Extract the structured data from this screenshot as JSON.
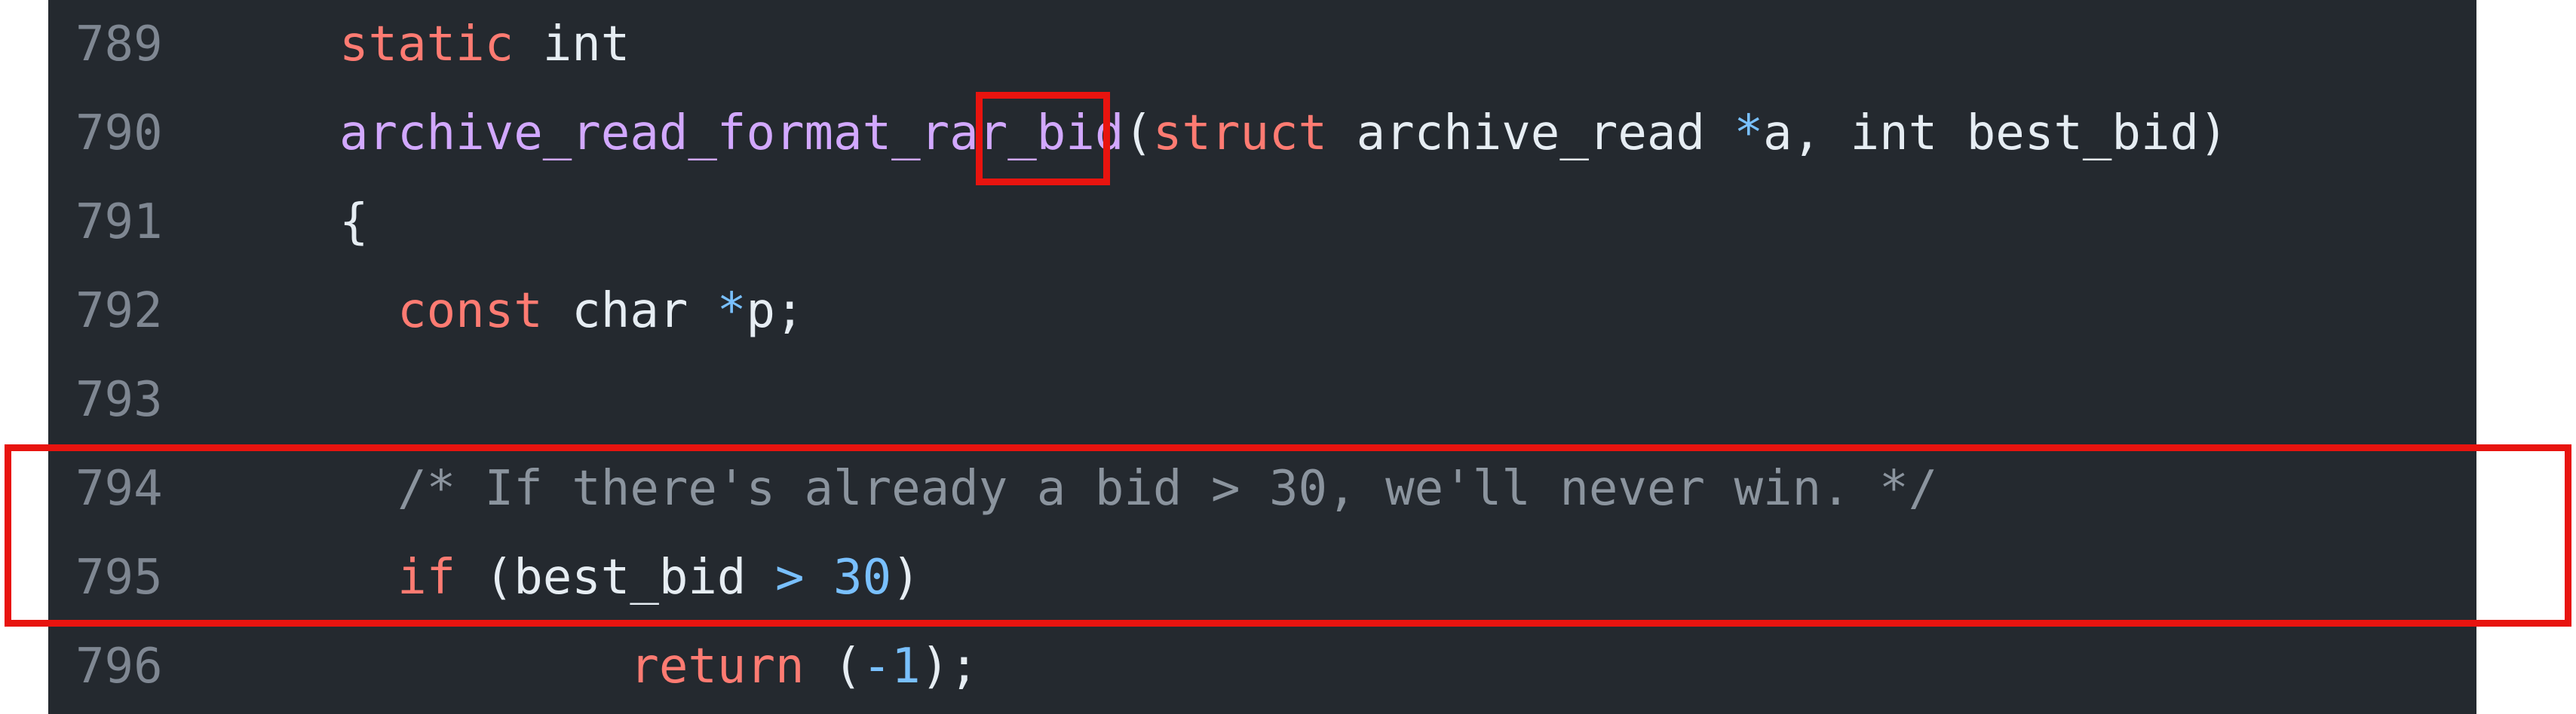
{
  "code_view": {
    "colors": {
      "background": "#24292f",
      "line_number": "#7f8792",
      "keyword": "#ff7b72",
      "function": "#d2a8ff",
      "operator": "#79c0ff",
      "number": "#79c0ff",
      "comment": "#8b949e",
      "plain": "#e6edf3",
      "annotation_box": "#e8140f"
    },
    "lines": [
      {
        "number": "789",
        "tokens": [
          {
            "text": "static",
            "kind": "keyword"
          },
          {
            "text": " int",
            "kind": "plain"
          }
        ]
      },
      {
        "number": "790",
        "tokens": [
          {
            "text": "archive_read_format_rar_bid",
            "kind": "function"
          },
          {
            "text": "(",
            "kind": "plain"
          },
          {
            "text": "struct",
            "kind": "keyword"
          },
          {
            "text": " archive_read ",
            "kind": "plain"
          },
          {
            "text": "*",
            "kind": "operator"
          },
          {
            "text": "a, int best_bid)",
            "kind": "plain"
          }
        ]
      },
      {
        "number": "791",
        "tokens": [
          {
            "text": "{",
            "kind": "plain"
          }
        ]
      },
      {
        "number": "792",
        "tokens": [
          {
            "text": "  ",
            "kind": "plain"
          },
          {
            "text": "const",
            "kind": "keyword"
          },
          {
            "text": " char ",
            "kind": "plain"
          },
          {
            "text": "*",
            "kind": "operator"
          },
          {
            "text": "p;",
            "kind": "plain"
          }
        ]
      },
      {
        "number": "793",
        "tokens": []
      },
      {
        "number": "794",
        "tokens": [
          {
            "text": "  ",
            "kind": "plain"
          },
          {
            "text": "/* If there's already a bid > 30, we'll never win. */",
            "kind": "comment"
          }
        ]
      },
      {
        "number": "795",
        "tokens": [
          {
            "text": "  ",
            "kind": "plain"
          },
          {
            "text": "if",
            "kind": "keyword"
          },
          {
            "text": " (best_bid ",
            "kind": "plain"
          },
          {
            "text": ">",
            "kind": "operator"
          },
          {
            "text": " ",
            "kind": "plain"
          },
          {
            "text": "30",
            "kind": "number"
          },
          {
            "text": ")",
            "kind": "plain"
          }
        ]
      },
      {
        "number": "796",
        "tokens": [
          {
            "text": "          ",
            "kind": "plain"
          },
          {
            "text": "return",
            "kind": "keyword"
          },
          {
            "text": " (",
            "kind": "plain"
          },
          {
            "text": "-1",
            "kind": "number"
          },
          {
            "text": ");",
            "kind": "plain"
          }
        ]
      }
    ]
  }
}
